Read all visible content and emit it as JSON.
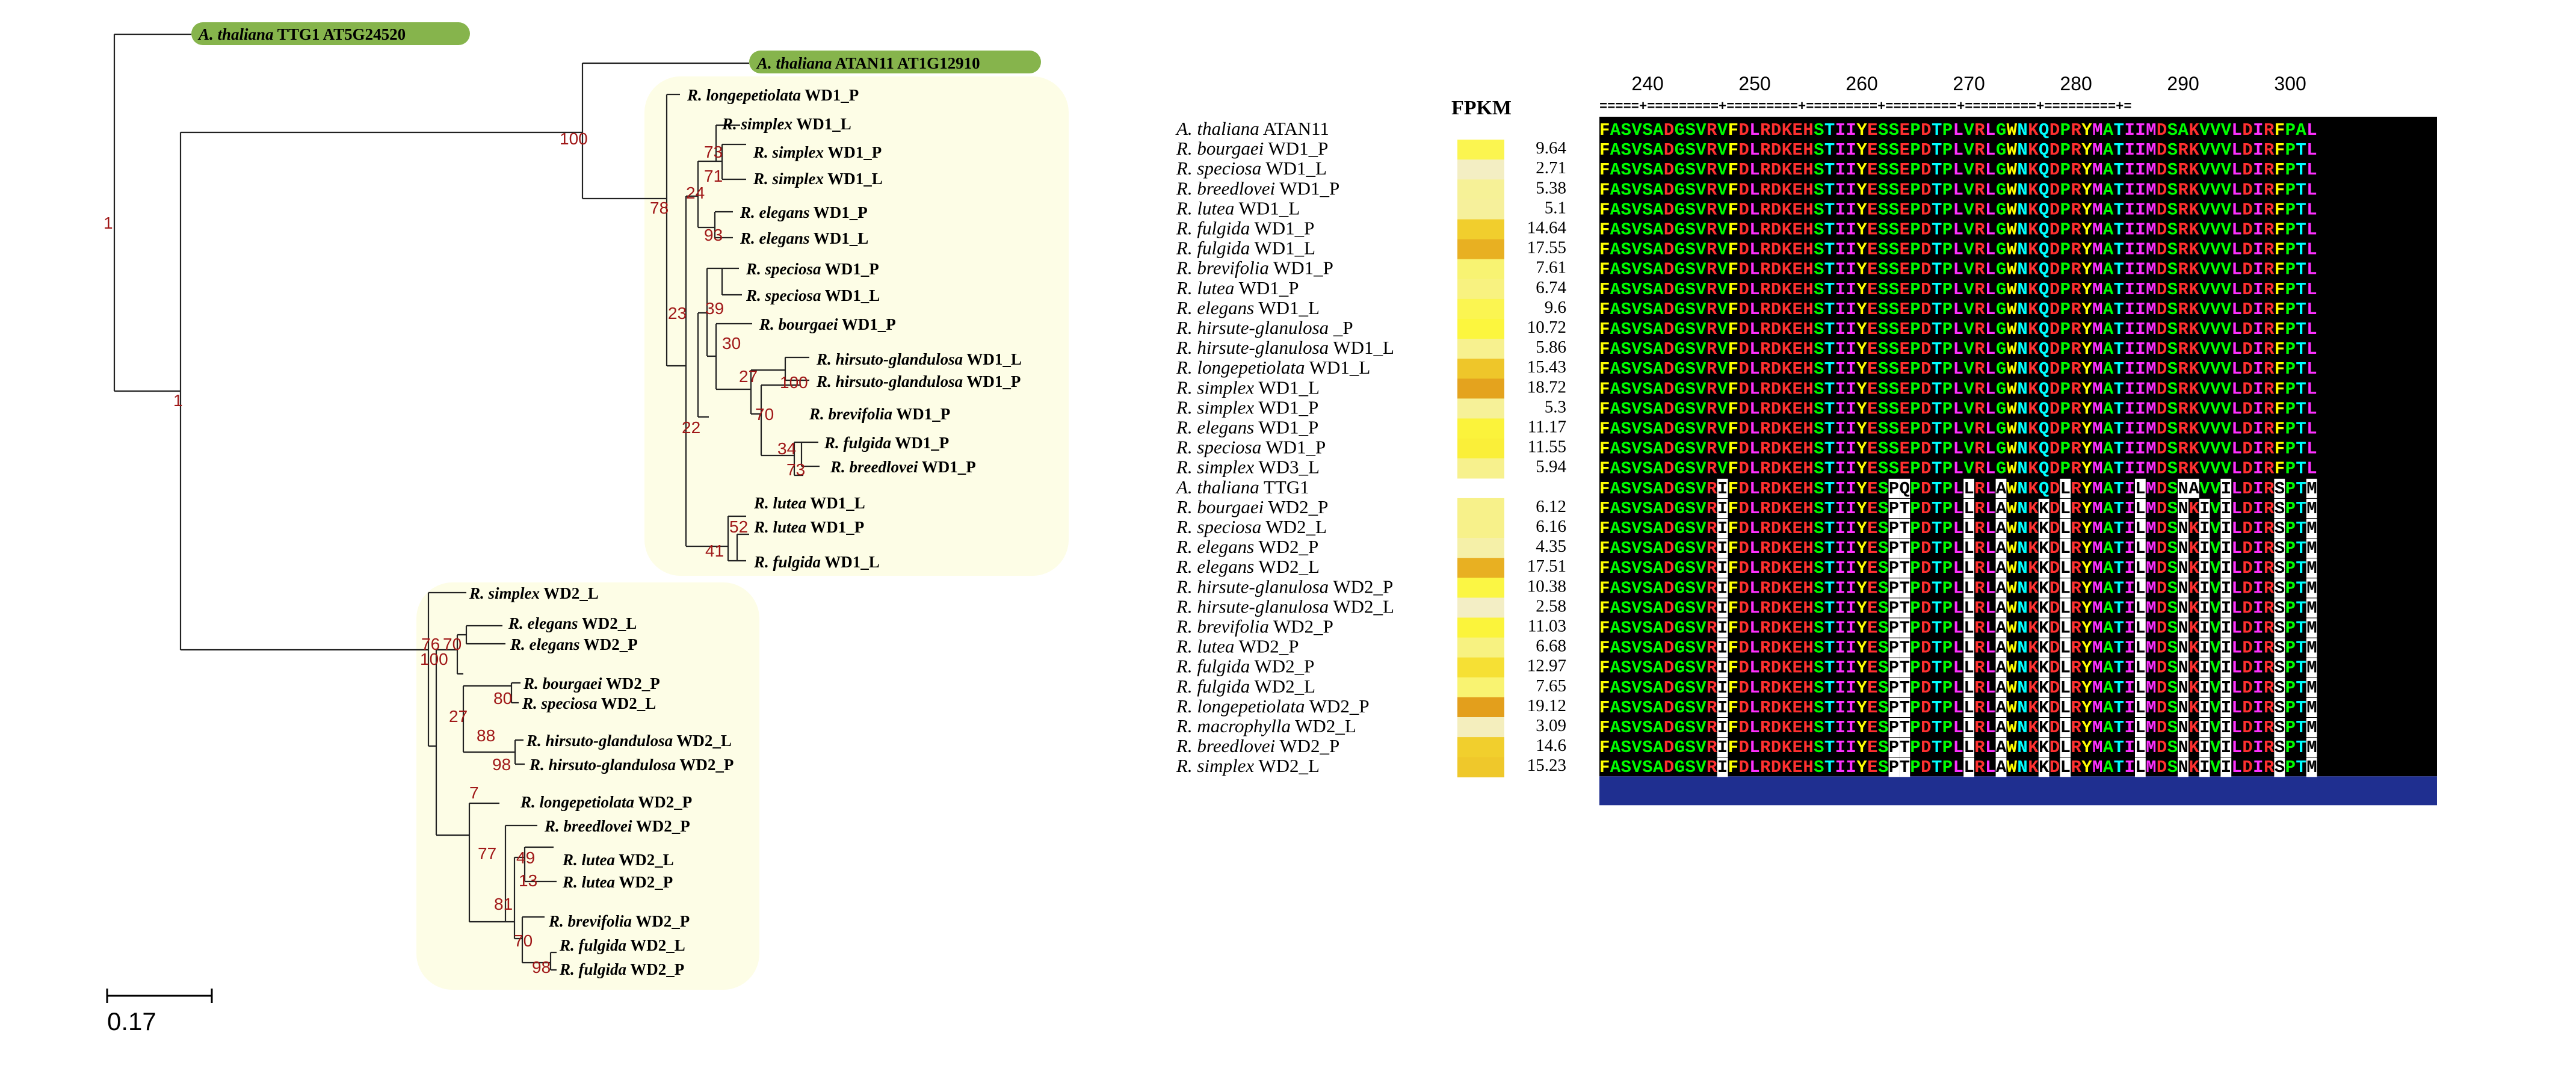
{
  "colors": {
    "clade_fill": "#fdfde6",
    "tip_highlight": "#86b44c",
    "bootstrap_text": "#a01818",
    "branch": "#222222",
    "alignment_bg": "#000000",
    "alignment_footer": "#1f2f90",
    "heat_low": "#f3eec5",
    "heat_high": "#e39f1c"
  },
  "tree": {
    "highlighted_tips": [
      {
        "species": "A. thaliana",
        "gene": "TTG1  AT5G24520"
      },
      {
        "species": "A. thaliana",
        "gene": "ATAN11  AT1G12910"
      }
    ],
    "wd1_tips": [
      {
        "species": "R. longepetiolata",
        "gene": "WD1_P"
      },
      {
        "species": "R. simplex",
        "gene": "WD1_L"
      },
      {
        "species": "R. simplex",
        "gene": "WD1_P"
      },
      {
        "species": "R. simplex",
        "gene": "WD1_L"
      },
      {
        "species": "R. elegans",
        "gene": "WD1_P"
      },
      {
        "species": "R. elegans",
        "gene": "WD1_L"
      },
      {
        "species": "R. speciosa",
        "gene": "WD1_P"
      },
      {
        "species": "R. speciosa",
        "gene": "WD1_L"
      },
      {
        "species": "R. bourgaei",
        "gene": "WD1_P"
      },
      {
        "species": "R. hirsuto-glandulosa",
        "gene": "WD1_L"
      },
      {
        "species": "R. hirsuto-glandulosa",
        "gene": "WD1_P"
      },
      {
        "species": "R. brevifolia",
        "gene": "WD1_P"
      },
      {
        "species": "R. fulgida",
        "gene": "WD1_P"
      },
      {
        "species": "R. breedlovei",
        "gene": "WD1_P"
      },
      {
        "species": "R. lutea",
        "gene": "WD1_L"
      },
      {
        "species": "R. lutea",
        "gene": "WD1_P"
      },
      {
        "species": "R. fulgida",
        "gene": "WD1_L"
      }
    ],
    "wd2_tips": [
      {
        "species": "R. simplex",
        "gene": "WD2_L"
      },
      {
        "species": "R. elegans",
        "gene": "WD2_L"
      },
      {
        "species": "R. elegans",
        "gene": "WD2_P"
      },
      {
        "species": "R. bourgaei",
        "gene": "WD2_P"
      },
      {
        "species": "R. speciosa",
        "gene": "WD2_L"
      },
      {
        "species": "R. hirsuto-glandulosa",
        "gene": "WD2_L"
      },
      {
        "species": "R. hirsuto-glandulosa",
        "gene": "WD2_P"
      },
      {
        "species": "R. longepetiolata",
        "gene": "WD2_P"
      },
      {
        "species": "R. breedlovei",
        "gene": "WD2_P"
      },
      {
        "species": "R. lutea",
        "gene": "WD2_L"
      },
      {
        "species": "R. lutea",
        "gene": "WD2_P"
      },
      {
        "species": "R. brevifolia",
        "gene": "WD2_P"
      },
      {
        "species": "R. fulgida",
        "gene": "WD2_L"
      },
      {
        "species": "R. fulgida",
        "gene": "WD2_P"
      }
    ],
    "bootstrap": [
      "1",
      "1",
      "100",
      "78",
      "73",
      "71",
      "24",
      "93",
      "23",
      "39",
      "30",
      "27",
      "100",
      "70",
      "34",
      "73",
      "22",
      "52",
      "41",
      "100",
      "76",
      "70",
      "27",
      "80",
      "88",
      "98",
      "7",
      "77",
      "49",
      "13",
      "81",
      "70",
      "98"
    ],
    "scale_label": "0.17"
  },
  "heatmap": {
    "header": "FPKM",
    "rows": [
      {
        "species": "A. thaliana",
        "gene": "ATAN11",
        "fpkm": null,
        "value": ""
      },
      {
        "species": "R. bourgaei",
        "gene": "WD1_P",
        "fpkm": 9.64,
        "value": "9.64"
      },
      {
        "species": "R. speciosa",
        "gene": "WD1_L",
        "fpkm": 2.71,
        "value": "2.71"
      },
      {
        "species": "R. breedlovei",
        "gene": "WD1_P",
        "fpkm": 5.38,
        "value": "5.38"
      },
      {
        "species": "R. lutea",
        "gene": "WD1_L",
        "fpkm": 5.1,
        "value": "5.1"
      },
      {
        "species": "R. fulgida",
        "gene": "WD1_P",
        "fpkm": 14.64,
        "value": "14.64"
      },
      {
        "species": "R. fulgida",
        "gene": "WD1_L",
        "fpkm": 17.55,
        "value": "17.55"
      },
      {
        "species": "R. brevifolia",
        "gene": "WD1_P",
        "fpkm": 7.61,
        "value": "7.61"
      },
      {
        "species": "R. lutea",
        "gene": "WD1_P",
        "fpkm": 6.74,
        "value": "6.74"
      },
      {
        "species": "R. elegans",
        "gene": "WD1_L",
        "fpkm": 9.6,
        "value": "9.6"
      },
      {
        "species": "R. hirsute-glanulosa",
        "gene": "_P",
        "fpkm": 10.72,
        "value": "10.72"
      },
      {
        "species": "R. hirsute-glanulosa",
        "gene": "WD1_L",
        "fpkm": 5.86,
        "value": "5.86"
      },
      {
        "species": "R. longepetiolata",
        "gene": "WD1_L",
        "fpkm": 15.43,
        "value": "15.43"
      },
      {
        "species": "R. simplex",
        "gene": "WD1_L",
        "fpkm": 18.72,
        "value": "18.72"
      },
      {
        "species": "R. simplex",
        "gene": "WD1_P",
        "fpkm": 5.3,
        "value": "5.3"
      },
      {
        "species": "R. elegans",
        "gene": "WD1_P",
        "fpkm": 11.17,
        "value": "11.17"
      },
      {
        "species": "R. speciosa",
        "gene": "WD1_P",
        "fpkm": 11.55,
        "value": "11.55"
      },
      {
        "species": "R. simplex",
        "gene": "WD3_L",
        "fpkm": 5.94,
        "value": "5.94"
      },
      {
        "species": "A. thaliana",
        "gene": "TTG1",
        "fpkm": null,
        "value": ""
      },
      {
        "species": "R. bourgaei",
        "gene": "WD2_P",
        "fpkm": 6.12,
        "value": "6.12"
      },
      {
        "species": "R. speciosa",
        "gene": "WD2_L",
        "fpkm": 6.16,
        "value": "6.16"
      },
      {
        "species": "R. elegans",
        "gene": "WD2_P",
        "fpkm": 4.35,
        "value": "4.35"
      },
      {
        "species": "R. elegans",
        "gene": "WD2_L",
        "fpkm": 17.51,
        "value": "17.51"
      },
      {
        "species": "R. hirsute-glanulosa",
        "gene": "WD2_P",
        "fpkm": 10.38,
        "value": "10.38"
      },
      {
        "species": "R. hirsute-glanulosa",
        "gene": "WD2_L",
        "fpkm": 2.58,
        "value": "2.58"
      },
      {
        "species": "R. brevifolia",
        "gene": "WD2_P",
        "fpkm": 11.03,
        "value": "11.03"
      },
      {
        "species": "R. lutea",
        "gene": "WD2_P",
        "fpkm": 6.68,
        "value": "6.68"
      },
      {
        "species": "R. fulgida",
        "gene": "WD2_P",
        "fpkm": 12.97,
        "value": "12.97"
      },
      {
        "species": "R. fulgida",
        "gene": "WD2_L",
        "fpkm": 7.65,
        "value": "7.65"
      },
      {
        "species": "R. longepetiolata",
        "gene": "WD2_P",
        "fpkm": 19.12,
        "value": "19.12"
      },
      {
        "species": "R. macrophylla",
        "gene": "WD2_L",
        "fpkm": 3.09,
        "value": "3.09"
      },
      {
        "species": "R. breedlovei",
        "gene": "WD2_P",
        "fpkm": 14.6,
        "value": "14.6"
      },
      {
        "species": "R. simplex",
        "gene": "WD2_L",
        "fpkm": 15.23,
        "value": "15.23"
      }
    ]
  },
  "alignment": {
    "positions": [
      "240",
      "250",
      "260",
      "270",
      "280",
      "290",
      "300"
    ],
    "ruler": "=====+=========+=========+=========+=========+=========+=========+=",
    "wd1_sequence": "FASVSADGSVRVFDLRDKEHSTIIYESSEPDTPLVRLGWNKQDPRYMATIIMDSRKVVVLDIRFPTL",
    "atan11_sequence": "FASVSADGSVRVFDLRDKEHSTIIYESSEPDTPLVRLGWNKQDPRYMATIIMDSAKVVVLDIRFPAL",
    "wd2_sequence": "FASVSADGSVRIFDLRDKEHSTIIYESPTPDTPLLRLAWNKKDLRYMATILMDSNKIVILDIRSPTM",
    "ttg1_sequence": "FASVSADGSVRIFDLRDKEHSTIIYESPQPDTPLLRLAWNKQDLRYMATILMDSNAVVILDIRSPTM"
  }
}
